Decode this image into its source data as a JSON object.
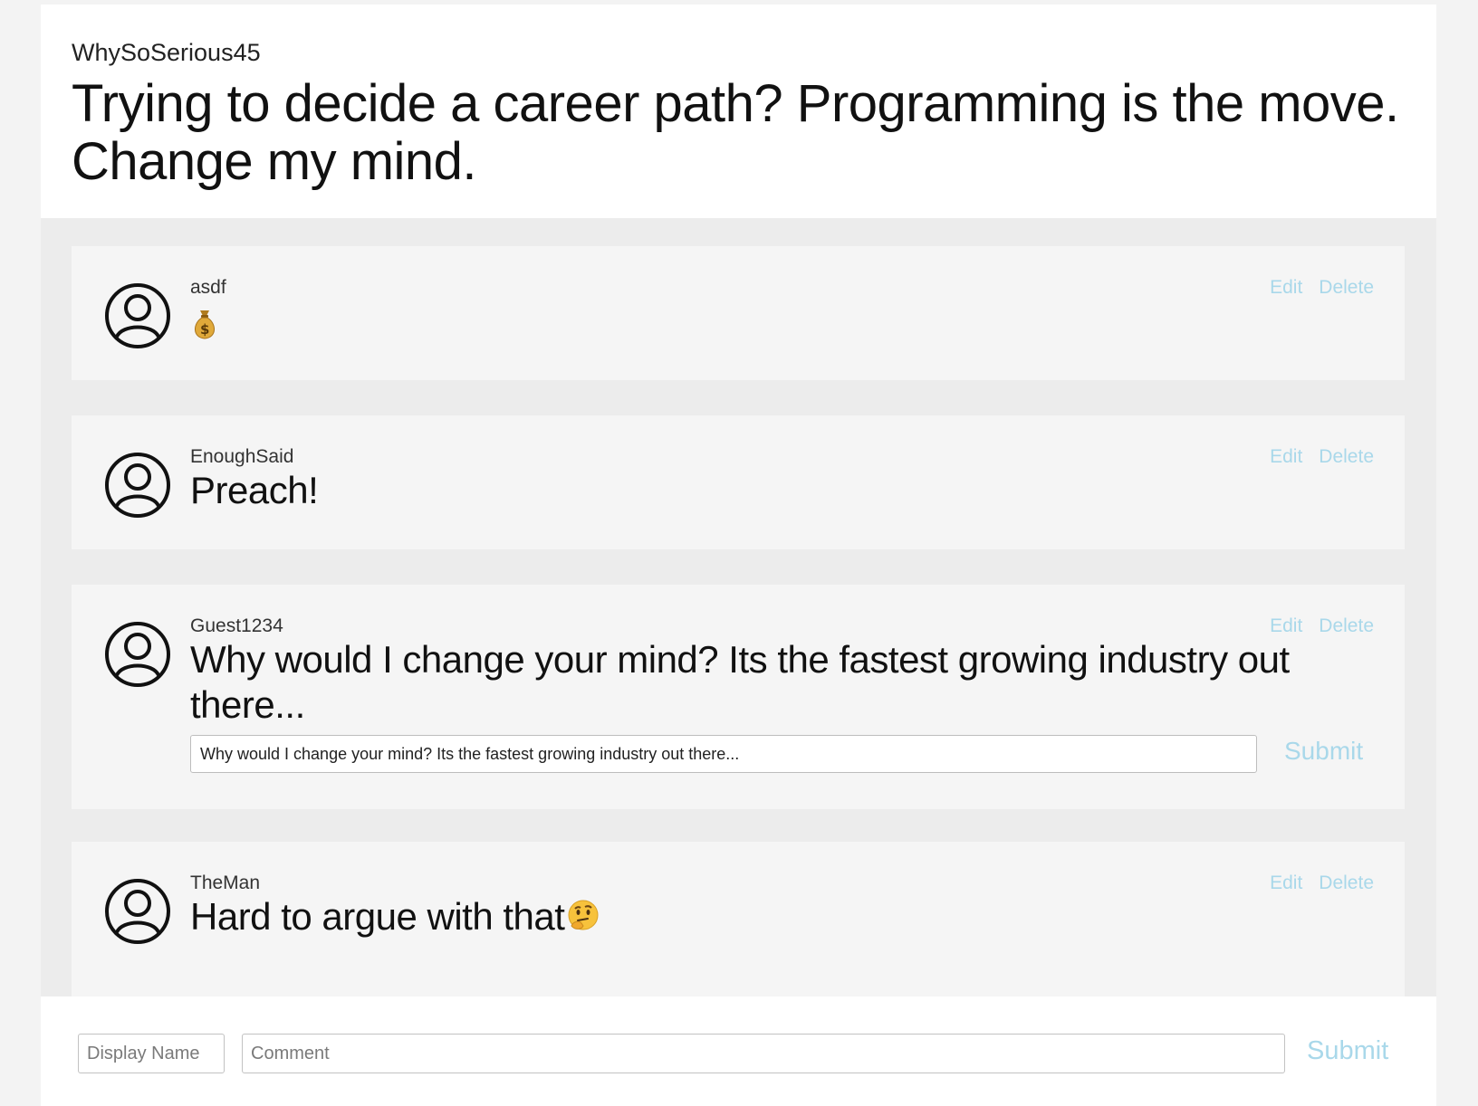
{
  "post": {
    "author": "WhySoSerious45",
    "title": "Trying to decide a career path? Programming is the move. Change my mind."
  },
  "comments": [
    {
      "author": "asdf",
      "text": "",
      "emoji": "money-bag-emoji",
      "edit_label": "Edit",
      "delete_label": "Delete"
    },
    {
      "author": "EnoughSaid",
      "text": "Preach!",
      "edit_label": "Edit",
      "delete_label": "Delete"
    },
    {
      "author": "Guest1234",
      "text": "Why would I change your mind? Its the fastest growing industry out there...",
      "edit_label": "Edit",
      "delete_label": "Delete",
      "editing": {
        "value": "Why would I change your mind? Its the fastest growing industry out there...",
        "submit_label": "Submit"
      }
    },
    {
      "author": "TheMan",
      "text": "Hard to argue with that",
      "emoji": "thinking-face-emoji",
      "edit_label": "Edit",
      "delete_label": "Delete"
    }
  ],
  "new_comment": {
    "name_placeholder": "Display Name",
    "comment_placeholder": "Comment",
    "submit_label": "Submit"
  },
  "colors": {
    "action_link": "#a9d8ea",
    "card_bg": "#f5f5f5",
    "list_bg": "#ececec"
  }
}
